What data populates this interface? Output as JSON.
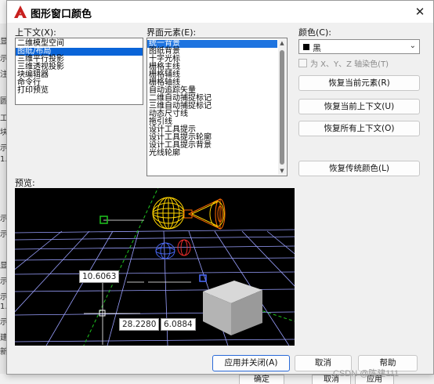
{
  "background": {
    "left_strip": [
      "显",
      "示",
      "注",
      "圆",
      "工",
      "块",
      "示",
      "1.",
      "示",
      "示",
      "显",
      "示",
      "示",
      "1.",
      "示",
      "建",
      "新"
    ],
    "bottom_buttons": [
      "确定",
      "取消",
      "应用(A)",
      "帮助"
    ]
  },
  "dialog": {
    "title": "图形窗口颜色",
    "close_glyph": "✕",
    "context": {
      "label": "上下文(X):",
      "items": [
        "二维模型空间",
        "图纸/布局",
        "三维平行投影",
        "三维透视投影",
        "块编辑器",
        "命令行",
        "打印预览"
      ],
      "selected_index": 1
    },
    "elements": {
      "label": "界面元素(E):",
      "items": [
        "统一背景",
        "图纸背景",
        "十字光标",
        "栅格主线",
        "栅格辅线",
        "栅格轴线",
        "自动追踪矢量",
        "二维自动捕捉标记",
        "三维自动捕捉标记",
        "动态尺寸线",
        "拖引线",
        "设计工具提示",
        "设计工具提示轮廓",
        "设计工具提示背景",
        "光线轮廓"
      ],
      "selected_index": 0
    },
    "color": {
      "label": "颜色(C):",
      "value": "黑",
      "swatch": "#000000"
    },
    "tint_checkbox": {
      "label": "为 X、Y、Z 轴染色(T)",
      "checked": false,
      "enabled": false
    },
    "buttons": {
      "restore_element": "恢复当前元素(R)",
      "restore_context": "恢复当前上下文(U)",
      "restore_all": "恢复所有上下文(O)",
      "restore_classic": "恢复传统颜色(L)",
      "apply_close": "应用并关闭(A)",
      "cancel": "取消",
      "help": "帮助"
    },
    "preview": {
      "label": "预览:",
      "dim1": "10.6063",
      "dim2": "28.2280",
      "dim3": "6.0884"
    }
  },
  "watermark": "CSDN @陈建111",
  "colors": {
    "accent": "#0a64d8",
    "preview_bg": "#000000",
    "grid": "#9aa0ff",
    "green": "#1fc41f",
    "yellow": "#ffd400",
    "orange": "#ff6a00"
  }
}
